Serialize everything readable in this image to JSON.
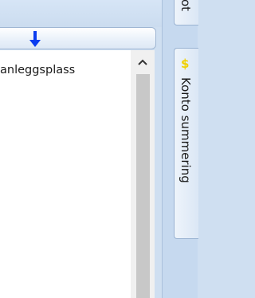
{
  "column_header": {
    "sort_icon": "arrow-down-icon"
  },
  "list": {
    "items": [
      {
        "text": "anleggsplass"
      }
    ]
  },
  "scrollbar": {
    "up_icon": "chevron-up-icon"
  },
  "side_tabs": [
    {
      "label": "ot"
    },
    {
      "label": "Konto summering",
      "icon": "dollar-icon",
      "icon_glyph": "$"
    }
  ],
  "colors": {
    "accent_blue": "#0a3cf0",
    "dollar_yellow": "#f0d000"
  }
}
